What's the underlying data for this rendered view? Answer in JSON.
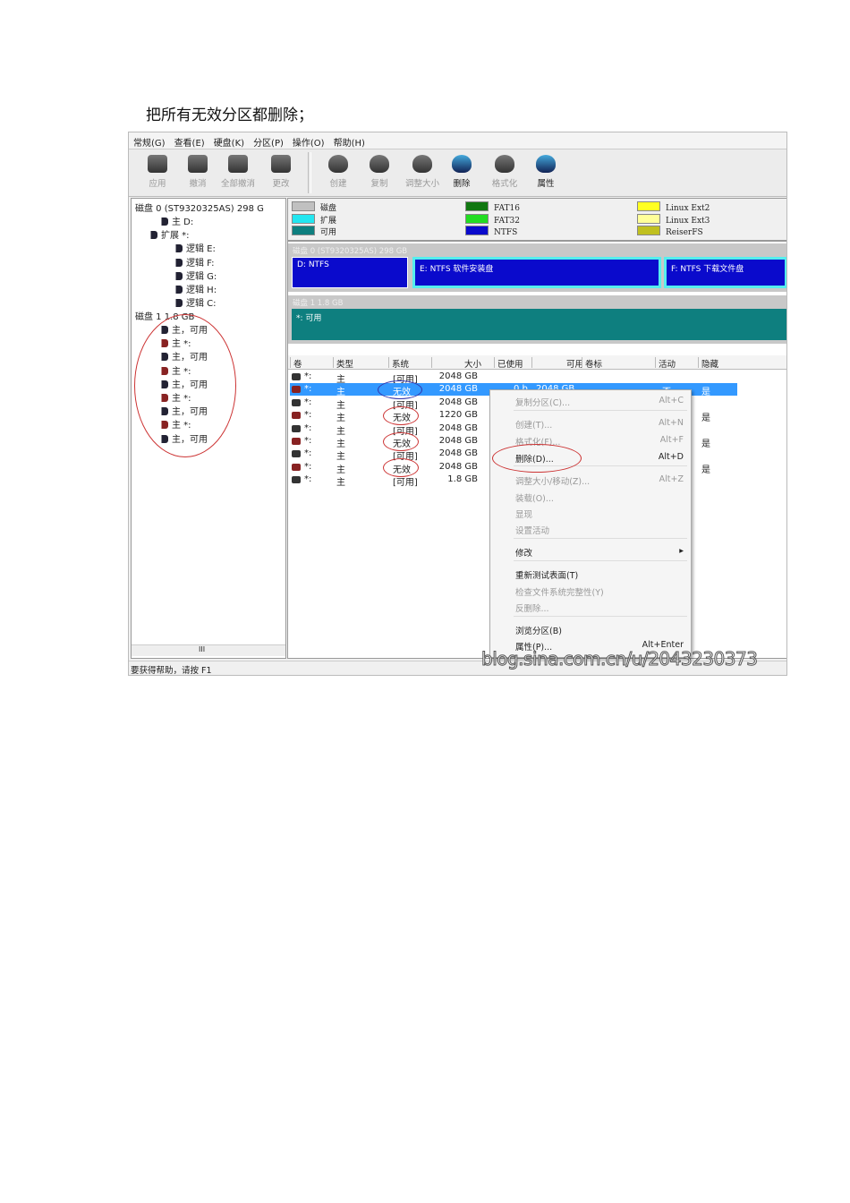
{
  "caption": "把所有无效分区都删除；",
  "menubar": [
    "常规(G)",
    "查看(E)",
    "硬盘(K)",
    "分区(P)",
    "操作(O)",
    "帮助(H)"
  ],
  "toolbar": {
    "group1": [
      {
        "label": "应用",
        "enabled": false
      },
      {
        "label": "撤消",
        "enabled": false
      },
      {
        "label": "全部撤消",
        "enabled": false
      },
      {
        "label": "更改",
        "enabled": false
      }
    ],
    "group2": [
      {
        "label": "创建",
        "enabled": false
      },
      {
        "label": "复制",
        "enabled": false
      },
      {
        "label": "调整大小",
        "enabled": false
      },
      {
        "label": "删除",
        "enabled": true
      },
      {
        "label": "格式化",
        "enabled": false
      },
      {
        "label": "属性",
        "enabled": true
      }
    ]
  },
  "tree": {
    "disk0": "磁盘 0 (ST9320325AS) 298 G",
    "disk0_items": [
      "主 D:",
      "扩展 *:",
      "逻辑 E:",
      "逻辑 F:",
      "逻辑 G:",
      "逻辑 H:",
      "逻辑 C:"
    ],
    "disk1": "磁盘 1 1.8 GB",
    "disk1_items": [
      "主，可用",
      "主 *:",
      "主，可用",
      "主 *:",
      "主，可用",
      "主 *:",
      "主，可用",
      "主 *:",
      "主，可用"
    ],
    "scroll_label": "III"
  },
  "legend": [
    {
      "label": "磁盘",
      "color": "#c0c0c0"
    },
    {
      "label": "扩展",
      "color": "#22e6f0"
    },
    {
      "label": "可用",
      "color": "#0e7f7f"
    },
    {
      "label": "FAT16",
      "color": "#117711"
    },
    {
      "label": "FAT32",
      "color": "#22dd22"
    },
    {
      "label": "NTFS",
      "color": "#0a0acc"
    },
    {
      "label": "Linux Ext2",
      "color": "#ffff22"
    },
    {
      "label": "Linux Ext3",
      "color": "#ffff99"
    },
    {
      "label": "ReiserFS",
      "color": "#c0c020"
    }
  ],
  "disk_map": {
    "disk0_title": "磁盘 0 (ST9320325AS) 298 GB",
    "disk0_parts": [
      "D: NTFS",
      "E: NTFS 软件安装盘",
      "F: NTFS 下载文件盘"
    ],
    "disk1_title": "磁盘 1 1.8 GB",
    "disk1_parts": [
      "*: 可用"
    ]
  },
  "list": {
    "headers": [
      "卷",
      "类型",
      "系统",
      "大小",
      "已使用",
      "可用",
      "卷标",
      "活动",
      "隐藏"
    ],
    "rows": [
      {
        "vol": "*:",
        "type": "主",
        "sys": "[可用]",
        "size": "2048 GB",
        "used": "",
        "free": "",
        "active": "",
        "hidden": ""
      },
      {
        "vol": "*:",
        "type": "主",
        "sys": "无效",
        "size": "2048 GB",
        "used": "0 b",
        "free": "2048 GB",
        "active": "否",
        "hidden": "是"
      },
      {
        "vol": "*:",
        "type": "主",
        "sys": "[可用]",
        "size": "2048 GB",
        "used": "",
        "free": "",
        "active": "",
        "hidden": ""
      },
      {
        "vol": "*:",
        "type": "主",
        "sys": "无效",
        "size": "1220 GB",
        "used": "",
        "free": "",
        "active": "",
        "hidden": "是"
      },
      {
        "vol": "*:",
        "type": "主",
        "sys": "[可用]",
        "size": "2048 GB",
        "used": "",
        "free": "",
        "active": "",
        "hidden": ""
      },
      {
        "vol": "*:",
        "type": "主",
        "sys": "无效",
        "size": "2048 GB",
        "used": "",
        "free": "",
        "active": "",
        "hidden": "是"
      },
      {
        "vol": "*:",
        "type": "主",
        "sys": "[可用]",
        "size": "2048 GB",
        "used": "",
        "free": "",
        "active": "",
        "hidden": ""
      },
      {
        "vol": "*:",
        "type": "主",
        "sys": "无效",
        "size": "2048 GB",
        "used": "",
        "free": "",
        "active": "",
        "hidden": "是"
      },
      {
        "vol": "*:",
        "type": "主",
        "sys": "[可用]",
        "size": "1.8 GB",
        "used": "",
        "free": "",
        "active": "",
        "hidden": ""
      }
    ]
  },
  "context_menu": [
    {
      "label": "复制分区(C)...",
      "key": "Alt+C",
      "enabled": false
    },
    {
      "label": "创建(T)...",
      "key": "Alt+N",
      "enabled": false
    },
    {
      "label": "格式化(F)...",
      "key": "Alt+F",
      "enabled": false
    },
    {
      "label": "删除(D)...",
      "key": "Alt+D",
      "enabled": true
    },
    {
      "label": "调整大小/移动(Z)...",
      "key": "Alt+Z",
      "enabled": false
    },
    {
      "label": "装载(O)...",
      "key": "",
      "enabled": false
    },
    {
      "label": "显现",
      "key": "",
      "enabled": false
    },
    {
      "label": "设置活动",
      "key": "",
      "enabled": false
    },
    {
      "label": "修改",
      "key": "▸",
      "enabled": true
    },
    {
      "label": "重新测试表面(T)",
      "key": "",
      "enabled": true
    },
    {
      "label": "检查文件系统完整性(Y)",
      "key": "",
      "enabled": false
    },
    {
      "label": "反删除...",
      "key": "",
      "enabled": false
    },
    {
      "label": "浏览分区(B)",
      "key": "",
      "enabled": true
    },
    {
      "label": "属性(P)...",
      "key": "Alt+Enter",
      "enabled": true
    }
  ],
  "status": "要获得帮助，请按 F1",
  "watermark": "blog.sina.com.cn/u/2043230373"
}
